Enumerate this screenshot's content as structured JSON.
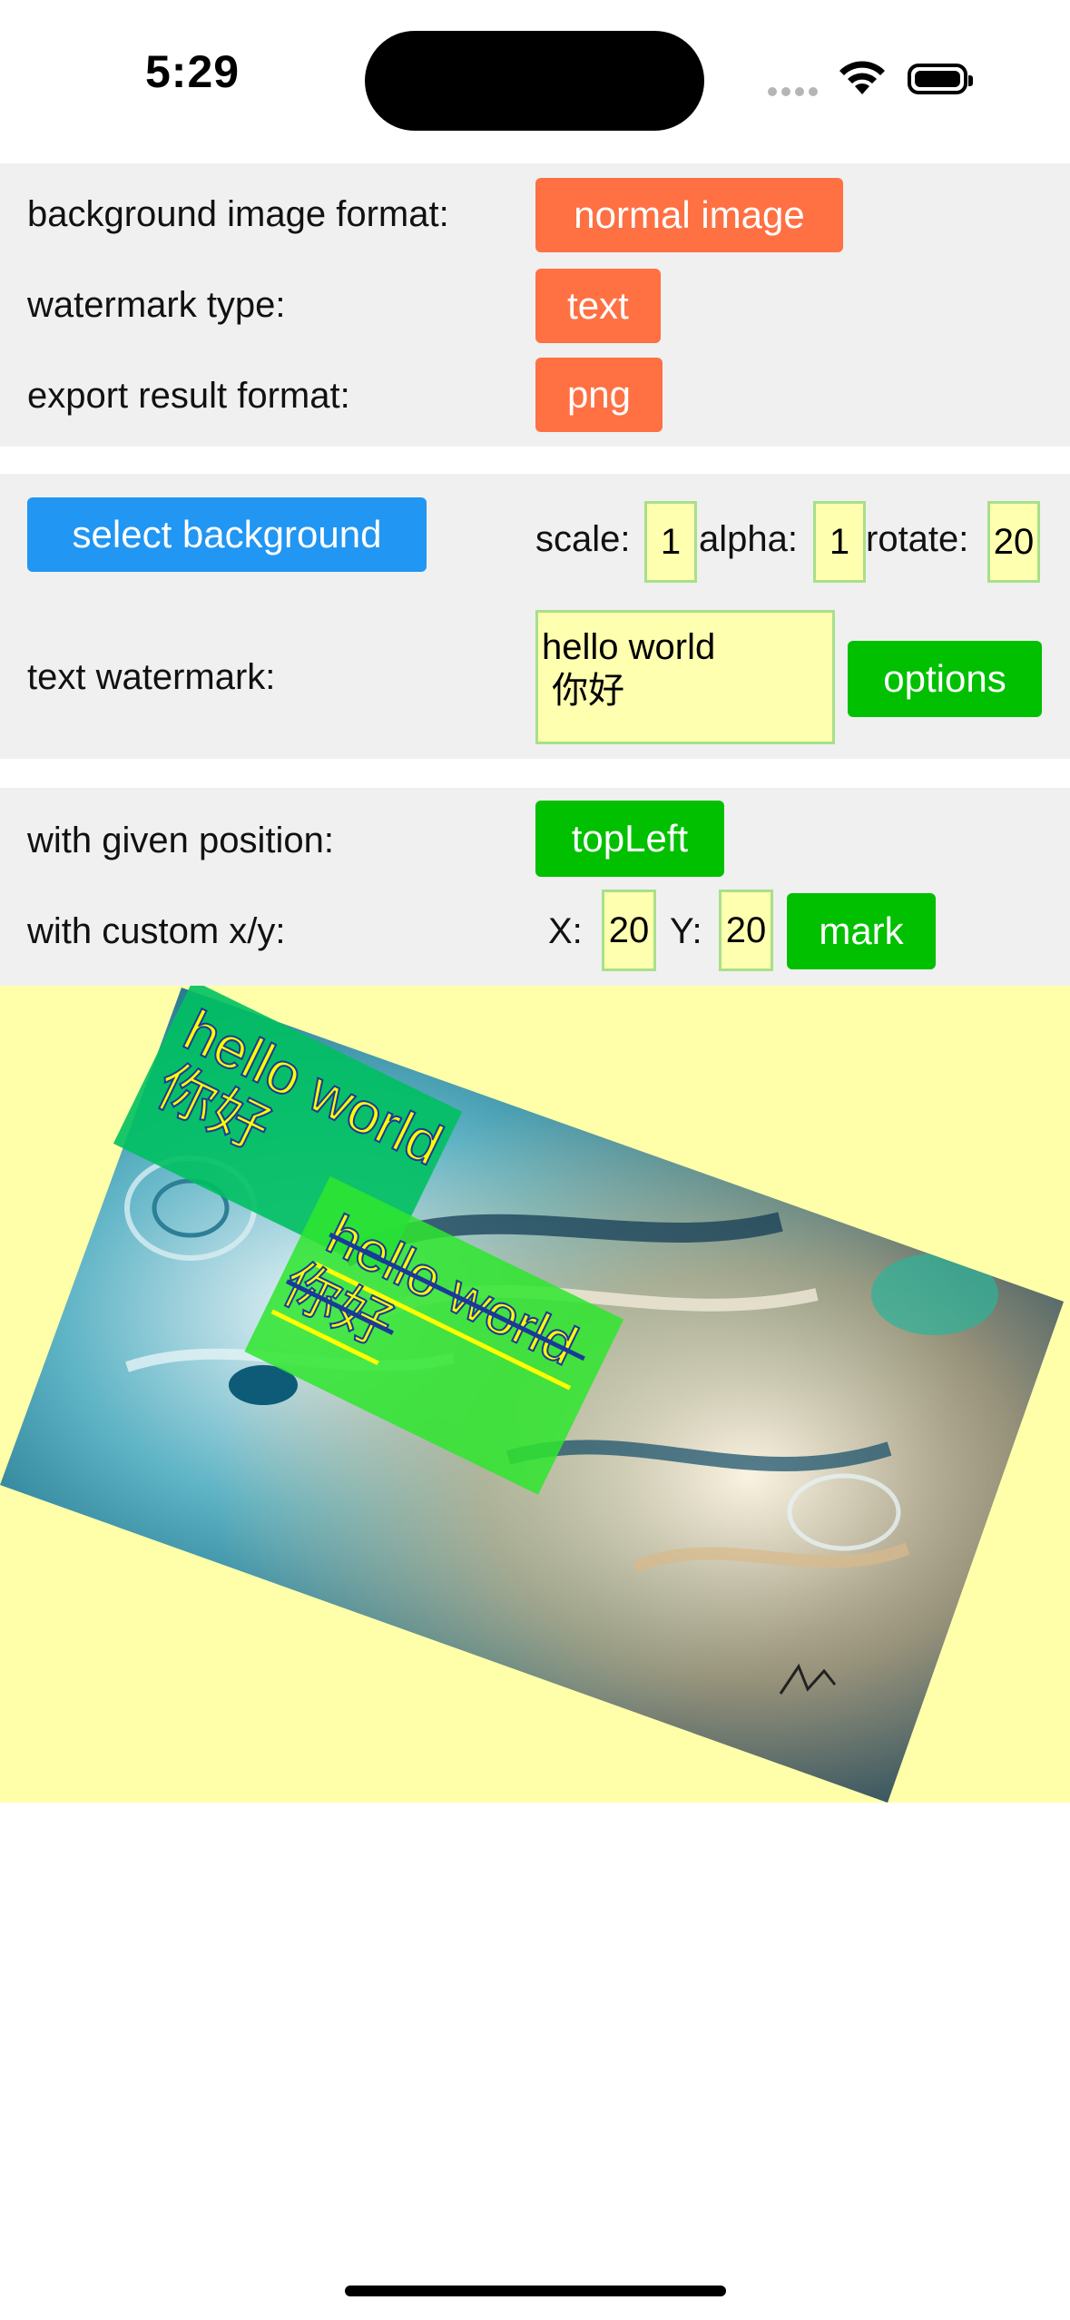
{
  "status_bar": {
    "time": "5:29"
  },
  "settings": {
    "bg_format_label": "background image format:",
    "bg_format_value": "normal image",
    "watermark_type_label": "watermark type:",
    "watermark_type_value": "text",
    "export_format_label": "export result format:",
    "export_format_value": "png"
  },
  "controls": {
    "select_background": "select background",
    "scale_label": "scale:",
    "scale_value": "1",
    "alpha_label": "alpha:",
    "alpha_value": "1",
    "rotate_label": "rotate:",
    "rotate_value": "20",
    "text_watermark_label": "text watermark:",
    "text_watermark_value": "hello world\n 你好",
    "options_button": "options"
  },
  "position": {
    "given_position_label": "with given position:",
    "given_position_value": "topLeft",
    "custom_xy_label": "with custom x/y:",
    "x_label": "X:",
    "x_value": "20",
    "y_label": "Y:",
    "y_value": "20",
    "mark_button": "mark"
  },
  "preview": {
    "watermark_line1": "hello world",
    "watermark_line2": "你好",
    "background_color": "#ffffaa"
  },
  "colors": {
    "orange": "#ff7043",
    "blue": "#2196f3",
    "green": "#00c000",
    "input_bg": "#ffffb0",
    "panel_bg": "#f0f0f0"
  }
}
